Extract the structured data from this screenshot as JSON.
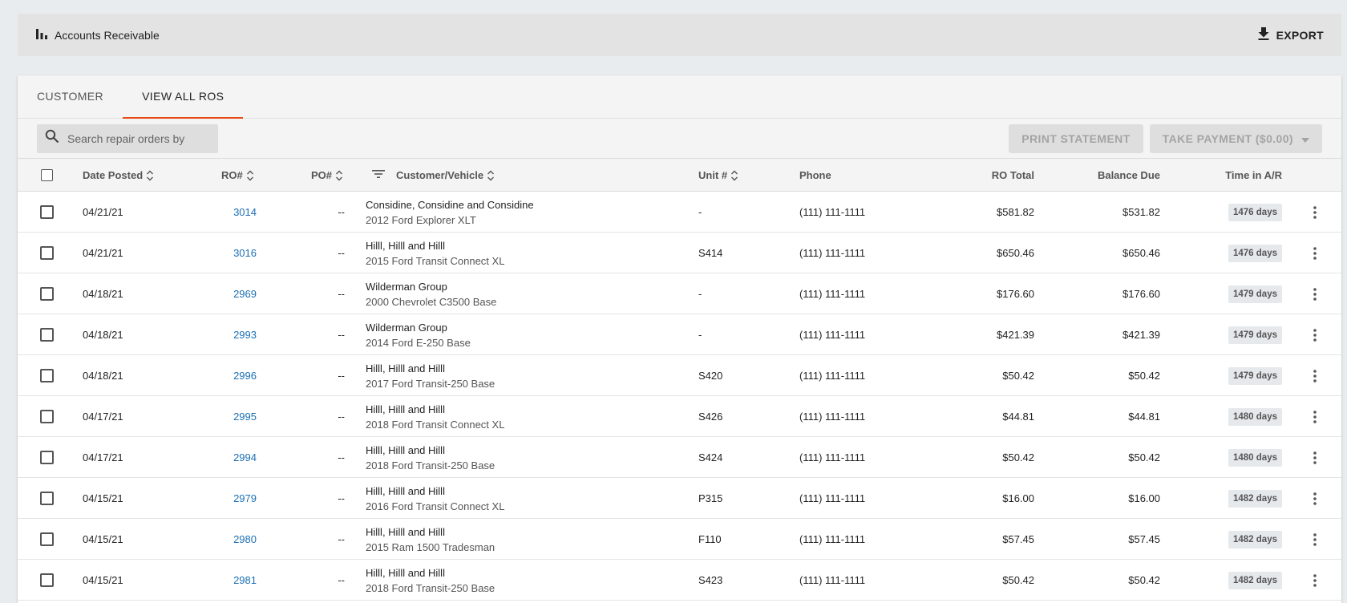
{
  "header": {
    "title": "Accounts Receivable",
    "export_label": "EXPORT"
  },
  "tabs": [
    {
      "label": "CUSTOMER",
      "active": false
    },
    {
      "label": "VIEW ALL ROS",
      "active": true
    }
  ],
  "toolbar": {
    "search_placeholder": "Search repair orders by",
    "print_label": "PRINT STATEMENT",
    "payment_label": "TAKE PAYMENT ($0.00)"
  },
  "columns": {
    "date": "Date Posted",
    "ro": "RO#",
    "po": "PO#",
    "customer": "Customer/Vehicle",
    "unit": "Unit #",
    "phone": "Phone",
    "ro_total": "RO Total",
    "balance": "Balance Due",
    "time": "Time in A/R"
  },
  "rows": [
    {
      "date": "04/21/21",
      "ro": "3014",
      "po": "--",
      "customer": "Considine, Considine and Considine",
      "vehicle": "2012 Ford Explorer XLT",
      "unit": "-",
      "phone": "(111) 111-1111",
      "ro_total": "$581.82",
      "balance": "$531.82",
      "time": "1476 days"
    },
    {
      "date": "04/21/21",
      "ro": "3016",
      "po": "--",
      "customer": "Hilll, Hilll and Hilll",
      "vehicle": "2015 Ford Transit Connect XL",
      "unit": "S414",
      "phone": "(111) 111-1111",
      "ro_total": "$650.46",
      "balance": "$650.46",
      "time": "1476 days"
    },
    {
      "date": "04/18/21",
      "ro": "2969",
      "po": "--",
      "customer": "Wilderman Group",
      "vehicle": "2000 Chevrolet C3500 Base",
      "unit": "-",
      "phone": "(111) 111-1111",
      "ro_total": "$176.60",
      "balance": "$176.60",
      "time": "1479 days"
    },
    {
      "date": "04/18/21",
      "ro": "2993",
      "po": "--",
      "customer": "Wilderman Group",
      "vehicle": "2014 Ford E-250 Base",
      "unit": "-",
      "phone": "(111) 111-1111",
      "ro_total": "$421.39",
      "balance": "$421.39",
      "time": "1479 days"
    },
    {
      "date": "04/18/21",
      "ro": "2996",
      "po": "--",
      "customer": "Hilll, Hilll and Hilll",
      "vehicle": "2017 Ford Transit-250 Base",
      "unit": "S420",
      "phone": "(111) 111-1111",
      "ro_total": "$50.42",
      "balance": "$50.42",
      "time": "1479 days"
    },
    {
      "date": "04/17/21",
      "ro": "2995",
      "po": "--",
      "customer": "Hilll, Hilll and Hilll",
      "vehicle": "2018 Ford Transit Connect XL",
      "unit": "S426",
      "phone": "(111) 111-1111",
      "ro_total": "$44.81",
      "balance": "$44.81",
      "time": "1480 days"
    },
    {
      "date": "04/17/21",
      "ro": "2994",
      "po": "--",
      "customer": "Hilll, Hilll and Hilll",
      "vehicle": "2018 Ford Transit-250 Base",
      "unit": "S424",
      "phone": "(111) 111-1111",
      "ro_total": "$50.42",
      "balance": "$50.42",
      "time": "1480 days"
    },
    {
      "date": "04/15/21",
      "ro": "2979",
      "po": "--",
      "customer": "Hilll, Hilll and Hilll",
      "vehicle": "2016 Ford Transit Connect XL",
      "unit": "P315",
      "phone": "(111) 111-1111",
      "ro_total": "$16.00",
      "balance": "$16.00",
      "time": "1482 days"
    },
    {
      "date": "04/15/21",
      "ro": "2980",
      "po": "--",
      "customer": "Hilll, Hilll and Hilll",
      "vehicle": "2015 Ram 1500 Tradesman",
      "unit": "F110",
      "phone": "(111) 111-1111",
      "ro_total": "$57.45",
      "balance": "$57.45",
      "time": "1482 days"
    },
    {
      "date": "04/15/21",
      "ro": "2981",
      "po": "--",
      "customer": "Hilll, Hilll and Hilll",
      "vehicle": "2018 Ford Transit-250 Base",
      "unit": "S423",
      "phone": "(111) 111-1111",
      "ro_total": "$50.42",
      "balance": "$50.42",
      "time": "1482 days"
    }
  ],
  "colors": {
    "accent": "#e64a19",
    "link": "#1a6fb4"
  },
  "icons": {
    "header": "bar-chart-icon",
    "export": "download-icon",
    "search": "search-icon",
    "sort": "sort-icon",
    "filter": "filter-icon",
    "row_menu": "more-vert-icon"
  }
}
